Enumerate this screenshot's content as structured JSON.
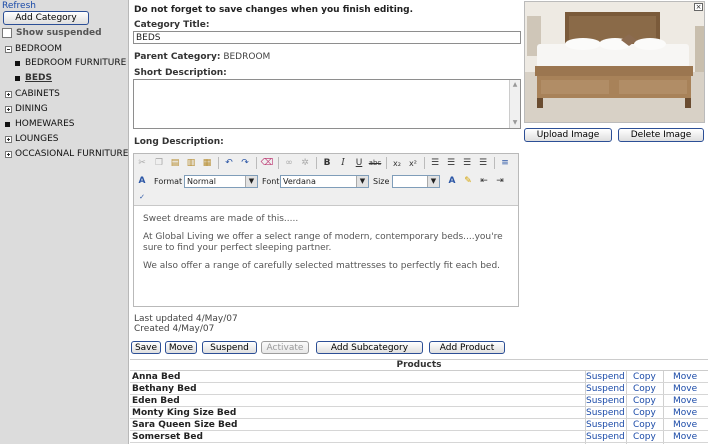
{
  "sidebar": {
    "refresh": "Refresh",
    "add_category": "Add Category",
    "show_suspended": "Show suspended",
    "tree": [
      {
        "label": "BEDROOM"
      },
      {
        "label": "BEDROOM FURNITURE"
      },
      {
        "label": "BEDS"
      },
      {
        "label": "CABINETS"
      },
      {
        "label": "DINING"
      },
      {
        "label": "HOMEWARES"
      },
      {
        "label": "LOUNGES"
      },
      {
        "label": "OCCASIONAL FURNITURE"
      }
    ]
  },
  "notice": "Do not forget to save changes when you finish editing.",
  "form": {
    "category_title_label": "Category Title:",
    "category_title_value": "BEDS",
    "parent_category_label": "Parent Category:",
    "parent_category_value": "BEDROOM",
    "short_description_label": "Short Description:",
    "long_description_label": "Long Description:"
  },
  "image": {
    "upload": "Upload Image",
    "delete": "Delete Image"
  },
  "toolbar": {
    "format_label": "Format",
    "format_value": "Normal",
    "font_label": "Font",
    "font_value": "Verdana",
    "size_label": "Size",
    "size_value": ""
  },
  "editor": {
    "paragraphs": [
      "Sweet dreams are made of this.....",
      "At Global Living we offer a select range of modern, contemporary beds....you're sure to find your perfect sleeping partner.",
      "We also offer a range of carefully selected mattresses to perfectly fit each bed."
    ]
  },
  "meta": {
    "last_updated": "Last updated 4/May/07",
    "created": "Created 4/May/07"
  },
  "actions": {
    "save": "Save",
    "move": "Move",
    "suspend": "Suspend",
    "activate": "Activate",
    "add_subcategory": "Add Subcategory",
    "add_product": "Add Product"
  },
  "products": {
    "heading": "Products",
    "rows": [
      {
        "name": "Anna Bed",
        "suspend": "Suspend",
        "copy": "Copy",
        "move": "Move"
      },
      {
        "name": "Bethany Bed",
        "suspend": "Suspend",
        "copy": "Copy",
        "move": "Move"
      },
      {
        "name": "Eden Bed",
        "suspend": "Suspend",
        "copy": "Copy",
        "move": "Move"
      },
      {
        "name": "Monty King Size Bed",
        "suspend": "Suspend",
        "copy": "Copy",
        "move": "Move"
      },
      {
        "name": "Sara Queen Size Bed",
        "suspend": "Suspend",
        "copy": "Copy",
        "move": "Move"
      },
      {
        "name": "Somerset Bed",
        "suspend": "Suspend",
        "copy": "Copy",
        "move": "Move"
      }
    ]
  },
  "colors": {
    "link": "#1a4aa8",
    "sidebar_bg": "#dcdcdc"
  }
}
